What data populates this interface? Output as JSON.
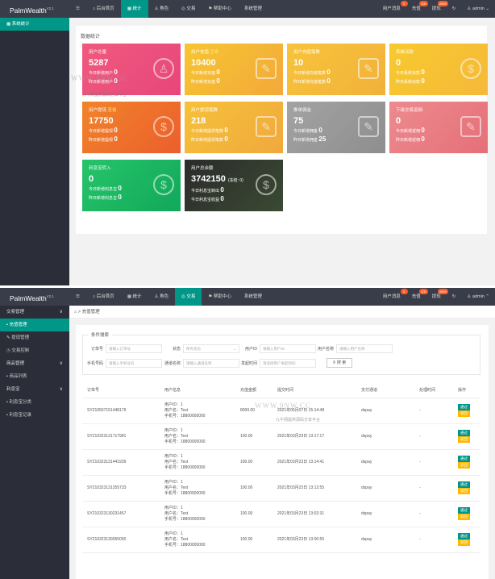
{
  "app": {
    "logo": "PalmWealth",
    "version": "V2.1"
  },
  "nav": {
    "menu_icon": "☰",
    "items": [
      {
        "icon": "⌂",
        "label": "后台首页"
      },
      {
        "icon": "▦",
        "label": "统计"
      },
      {
        "icon": "♙",
        "label": "角色"
      },
      {
        "icon": "◎",
        "label": "交易"
      },
      {
        "icon": "⚑",
        "label": "帮助中心"
      },
      {
        "label": "系统管理"
      }
    ]
  },
  "header_right": {
    "messages": {
      "label": "用户消息",
      "badge": "0"
    },
    "recharge": {
      "label": "充值",
      "badge": "400"
    },
    "withdraw": {
      "label": "提现",
      "badge": "2689"
    },
    "refresh_icon": "↻",
    "user": "admin"
  },
  "screen1": {
    "sidebar_item": "系统统计",
    "panel_title": "数据统计",
    "watermark": "WWW.9NW.CC",
    "watermark_sub": "九牛网提供源码分享平台",
    "cards": [
      {
        "title": "用户总量",
        "value": "5287",
        "r1_label": "今日新增用户",
        "r1_val": "0",
        "r2_label": "昨日新增用户",
        "r2_val": "0",
        "color": "#f05a7e",
        "color2": "#e7467a"
      },
      {
        "title": "用户充值",
        "title_hl": "查看",
        "value": "10400",
        "r1_label": "今日新增充值",
        "r1_val": "0",
        "r2_label": "昨日新增充值",
        "r2_val": "0",
        "color": "#f6c531",
        "color2": "#f3a93a"
      },
      {
        "title": "用户充值笔数",
        "value": "10",
        "r1_label": "今日新增充值笔数",
        "r1_val": "0",
        "r2_label": "昨日新增充值笔数",
        "r2_val": "0",
        "color": "#f7c43b",
        "color2": "#f2b13a"
      },
      {
        "title": "系统派款",
        "value": "0",
        "r1_label": "今日系统派款",
        "r1_val": "0",
        "r2_label": "昨日系统派款",
        "r2_val": "0",
        "color": "#f8c92e",
        "color2": "#f5b93a"
      },
      {
        "title": "用户提现",
        "title_hl": "查看",
        "value": "17750",
        "r1_label": "今日新增提现",
        "r1_val": "0",
        "r2_label": "昨日新增提现",
        "r2_val": "0",
        "color": "#f0842a",
        "color2": "#ec5e2c"
      },
      {
        "title": "用户提现笔数",
        "value": "218",
        "r1_label": "今日新增提现笔数",
        "r1_val": "0",
        "r2_label": "昨日新增提现笔数",
        "r2_val": "0",
        "color": "#f6c13a",
        "color2": "#f0a93c"
      },
      {
        "title": "推单佣金",
        "value": "75",
        "r1_label": "今日新增佣金",
        "r1_val": "0",
        "r2_label": "昨日新增佣金",
        "r2_val": "25",
        "color": "#a3a3a3",
        "color2": "#8e8e8e"
      },
      {
        "title": "下级交易返佣",
        "value": "0",
        "r1_label": "今日新增返佣",
        "r1_val": "0",
        "r2_label": "昨日新增返佣",
        "r2_val": "0",
        "color": "#ec8b8f",
        "color2": "#e66f78"
      },
      {
        "title": "利息宝转入",
        "value": "0",
        "r1_label": "今日新增利息宝",
        "r1_val": "0",
        "r2_label": "昨日新增利息宝",
        "r2_val": "0",
        "color": "#27c46a",
        "color2": "#11a85a"
      },
      {
        "title": "用户总余额",
        "value": "3742150",
        "value_note": "(冻结: 0)",
        "r1_label": "今日利息宝转出",
        "r1_val": "0",
        "r2_label": "今日利息宝收益",
        "r2_val": "0",
        "color": "#2b2b2b",
        "color2": "#3a4a32"
      }
    ]
  },
  "screen2": {
    "breadcrumb": "充值管理",
    "sidebar": [
      {
        "label": "交易管理",
        "type": "group",
        "arrow": "∨"
      },
      {
        "icon": "▪",
        "label": "充值管理",
        "type": "active"
      },
      {
        "icon": "✎",
        "label": "提现管理"
      },
      {
        "icon": "◷",
        "label": "交易控制"
      },
      {
        "label": "商品管理",
        "type": "group",
        "arrow": "∨"
      },
      {
        "icon": "▪",
        "label": "商品列表"
      },
      {
        "label": "利息宝",
        "type": "group",
        "arrow": "∨"
      },
      {
        "icon": "▪",
        "label": "利息宝分类"
      },
      {
        "icon": "▪",
        "label": "利息宝记录"
      }
    ],
    "search": {
      "legend": "条件搜索",
      "order_label": "订单号",
      "order_ph": "请输入订单号",
      "status_label": "状态",
      "status_val": "所有状态",
      "uid_label": "用户ID",
      "uid_ph": "请输入用户ID",
      "uname_label": "用户名称",
      "uname_ph": "请输入用户名称",
      "phone_label": "手机号码",
      "phone_ph": "请输入手机号码",
      "channel_label": "通道名称",
      "channel_ph": "请输入通道名称",
      "date_label": "发起时间",
      "date_ph": "请选择用户发起时间",
      "button": "搜 索"
    },
    "table": {
      "headers": [
        "订单号",
        "用户信息",
        "充值金额",
        "提交时间",
        "支付通道",
        "处理时间",
        "操作"
      ],
      "rows": [
        {
          "order": "SY210507151448179",
          "uid": "用户ID：1",
          "uname": "用户名：Test",
          "phone": "手机号：18800000000",
          "amount": "8000.00",
          "time": "2021年05月07日 15:14:48",
          "channel": "dspay",
          "ptime": "-"
        },
        {
          "order": "SY210323131717981",
          "uid": "用户ID：1",
          "uname": "用户名：Test",
          "phone": "手机号：18800000000",
          "amount": "100.00",
          "time": "2021年03月23日 13:17:17",
          "channel": "dspay",
          "ptime": "-"
        },
        {
          "order": "SY210323131441939",
          "uid": "用户ID：1",
          "uname": "用户名：Test",
          "phone": "手机号：18800000000",
          "amount": "100.00",
          "time": "2021年03月23日 13:14:41",
          "channel": "dspay",
          "ptime": "-"
        },
        {
          "order": "SY210323131255733",
          "uid": "用户ID：1",
          "uname": "用户名：Test",
          "phone": "手机号：18800000000",
          "amount": "100.00",
          "time": "2021年03月23日 13:12:55",
          "channel": "dspay",
          "ptime": "-"
        },
        {
          "order": "SY210323130231457",
          "uid": "用户ID：1",
          "uname": "用户名：Test",
          "phone": "手机号：18800000000",
          "amount": "100.00",
          "time": "2021年03月23日 13:02:31",
          "channel": "dspay",
          "ptime": "-"
        },
        {
          "order": "SY210323130055050",
          "uid": "用户ID：1",
          "uname": "用户名：Test",
          "phone": "手机号：18800000000",
          "amount": "100.00",
          "time": "2021年03月23日 13:00:55",
          "channel": "dspay",
          "ptime": "-"
        }
      ],
      "btn_pass": "通过",
      "btn_reject": "驳回"
    }
  }
}
